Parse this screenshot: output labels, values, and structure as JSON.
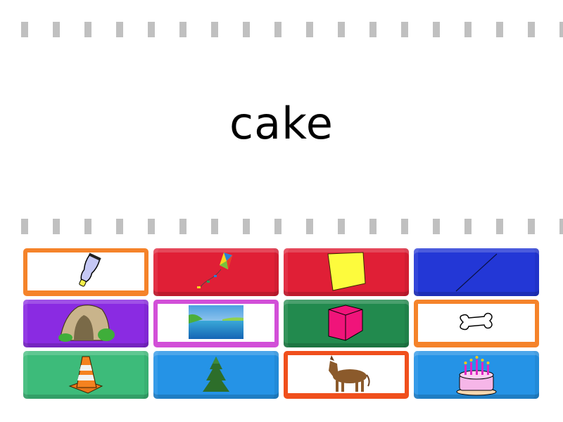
{
  "prompt": {
    "word": "cake"
  },
  "dashes": {
    "count": 18,
    "color": "#c0c0c0"
  },
  "tiles": [
    {
      "id": "toothpaste",
      "icon": "toothpaste-tube-icon",
      "style": "framed",
      "color": "#f5832a"
    },
    {
      "id": "kite",
      "icon": "kite-icon",
      "style": "solid",
      "color": "#e01f36"
    },
    {
      "id": "sticky-note",
      "icon": "sticky-note-icon",
      "style": "solid",
      "color": "#e01f36"
    },
    {
      "id": "line",
      "icon": "diagonal-line-icon",
      "style": "solid",
      "color": "#2337d6"
    },
    {
      "id": "cave",
      "icon": "cave-icon",
      "style": "solid",
      "color": "#8a2be2"
    },
    {
      "id": "lake",
      "icon": "lake-landscape-icon",
      "style": "framed",
      "color": "#d24fd8"
    },
    {
      "id": "cube",
      "icon": "pink-cube-icon",
      "style": "solid",
      "color": "#228a4e"
    },
    {
      "id": "bone",
      "icon": "bone-icon",
      "style": "framed",
      "color": "#f5832a"
    },
    {
      "id": "cone",
      "icon": "traffic-cone-icon",
      "style": "solid",
      "color": "#3dbb7a"
    },
    {
      "id": "tree",
      "icon": "pine-tree-icon",
      "style": "solid",
      "color": "#2593e6"
    },
    {
      "id": "donkey",
      "icon": "donkey-icon",
      "style": "framed",
      "color": "#f04f1c"
    },
    {
      "id": "cake",
      "icon": "birthday-cake-icon",
      "style": "solid",
      "color": "#2593e6"
    }
  ]
}
